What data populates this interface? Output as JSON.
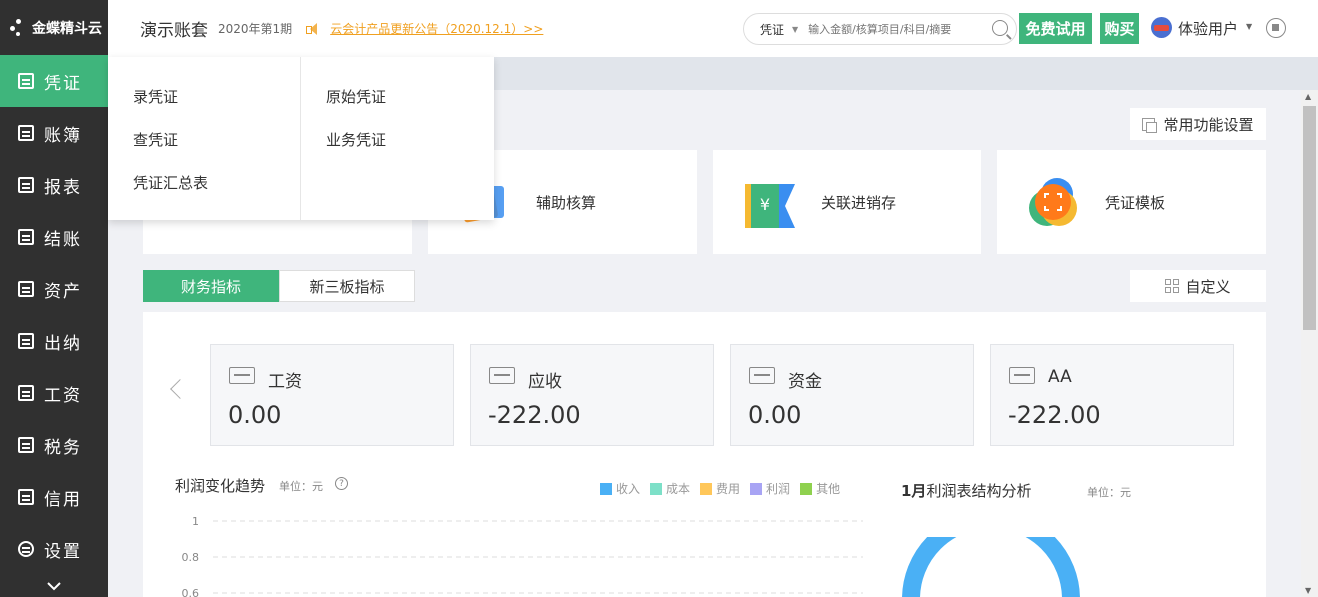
{
  "brand": {
    "name": "金蝶精斗云"
  },
  "sidebar": {
    "items": [
      {
        "label": "凭证",
        "active": true
      },
      {
        "label": "账簿"
      },
      {
        "label": "报表"
      },
      {
        "label": "结账"
      },
      {
        "label": "资产"
      },
      {
        "label": "出纳"
      },
      {
        "label": "工资"
      },
      {
        "label": "税务"
      },
      {
        "label": "信用"
      },
      {
        "label": "设置"
      }
    ],
    "more_icon": "chevron-down-icon"
  },
  "header": {
    "account_title": "演示账套",
    "period": "2020年第1期",
    "notice": "云会计产品更新公告（2020.12.1）>>",
    "search": {
      "type": "凭证",
      "placeholder": "输入金额/核算项目/科目/摘要"
    },
    "trial_label": "免费试用",
    "buy_label": "购买",
    "user_name": "体验用户"
  },
  "dropdown": {
    "col1": [
      "录凭证",
      "查凭证",
      "凭证汇总表"
    ],
    "col2": [
      "原始凭证",
      "业务凭证"
    ]
  },
  "main": {
    "common_settings_label": "常用功能设置",
    "func_cards": [
      "辅助核算",
      "关联进销存",
      "凭证模板"
    ],
    "tabs": [
      "财务指标",
      "新三板指标"
    ],
    "custom_label": "自定义",
    "metrics": [
      {
        "name": "工资",
        "value": "0.00"
      },
      {
        "name": "应收",
        "value": "-222.00"
      },
      {
        "name": "资金",
        "value": "0.00"
      },
      {
        "name": "AA",
        "value": "-222.00"
      }
    ],
    "trend": {
      "title": "利润变化趋势",
      "unit": "单位：元",
      "legend": [
        {
          "name": "收入",
          "color": "#4ab0f5"
        },
        {
          "name": "成本",
          "color": "#7de0c8"
        },
        {
          "name": "费用",
          "color": "#ffc75a"
        },
        {
          "name": "利润",
          "color": "#a8a4f4"
        },
        {
          "name": "其他",
          "color": "#8fd14f"
        }
      ]
    },
    "pie": {
      "title_month": "1月",
      "title_rest": "利润表结构分析",
      "unit": "单位：元"
    }
  },
  "chart_data": {
    "type": "line",
    "title": "利润变化趋势",
    "ylabel": "单位：元",
    "series": [
      {
        "name": "收入",
        "values": []
      },
      {
        "name": "成本",
        "values": []
      },
      {
        "name": "费用",
        "values": []
      },
      {
        "name": "利润",
        "values": []
      },
      {
        "name": "其他",
        "values": []
      }
    ],
    "y_ticks": [
      "1",
      "0.8",
      "0.6"
    ],
    "ylim": [
      0,
      1
    ],
    "grid": true,
    "legend": "top-right"
  },
  "colors": {
    "accent": "#3fb57c",
    "sidebar": "#303030",
    "notice": "#f0a020",
    "pie": "#4ab0f5"
  }
}
